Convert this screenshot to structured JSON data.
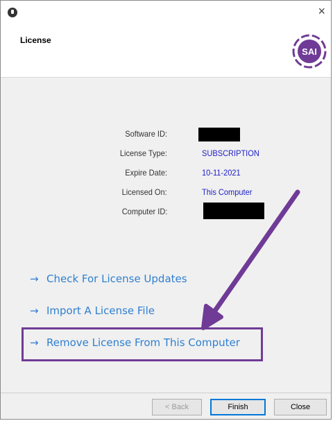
{
  "window": {
    "close_glyph": "×"
  },
  "header": {
    "title": "License",
    "logo_text": "SAI"
  },
  "fields": [
    {
      "label": "Software ID:",
      "value": ""
    },
    {
      "label": "License Type:",
      "value": "SUBSCRIPTION"
    },
    {
      "label": "Expire Date:",
      "value": "10-11-2021"
    },
    {
      "label": "Licensed On:",
      "value": "This Computer"
    },
    {
      "label": "Computer ID:",
      "value": ""
    }
  ],
  "links": [
    {
      "arrow": "→",
      "label": "Check For License Updates"
    },
    {
      "arrow": "→",
      "label": "Import A License File"
    },
    {
      "arrow": "→",
      "label": "Remove License From This Computer"
    }
  ],
  "buttons": {
    "back": "< Back",
    "finish": "Finish",
    "close": "Close"
  },
  "colors": {
    "accent": "#6f3b96",
    "link": "#2f7fd0",
    "value": "#2020c8"
  }
}
